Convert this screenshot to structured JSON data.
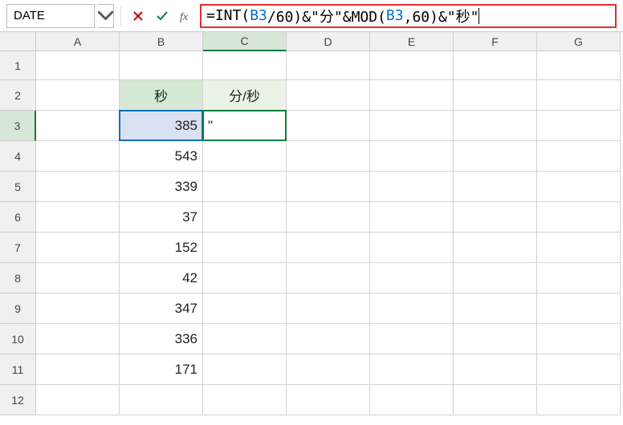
{
  "name_box": "DATE",
  "formula": {
    "p1": "=INT(",
    "p2": "B3",
    "p3": "/60)&\"分\"&MOD(",
    "p4": "B3",
    "p5": ",60)&\"秒\""
  },
  "columns": [
    "A",
    "B",
    "C",
    "D",
    "E",
    "F",
    "G"
  ],
  "rows": [
    "1",
    "2",
    "3",
    "4",
    "5",
    "6",
    "7",
    "8",
    "9",
    "10",
    "11",
    "12"
  ],
  "headers": {
    "b2": "秒",
    "c2": "分/秒"
  },
  "cells": {
    "b3": "385",
    "b4": "543",
    "b5": "339",
    "b6": "37",
    "b7": "152",
    "b8": "42",
    "b9": "347",
    "b10": "336",
    "b11": "171",
    "c3": "\""
  }
}
